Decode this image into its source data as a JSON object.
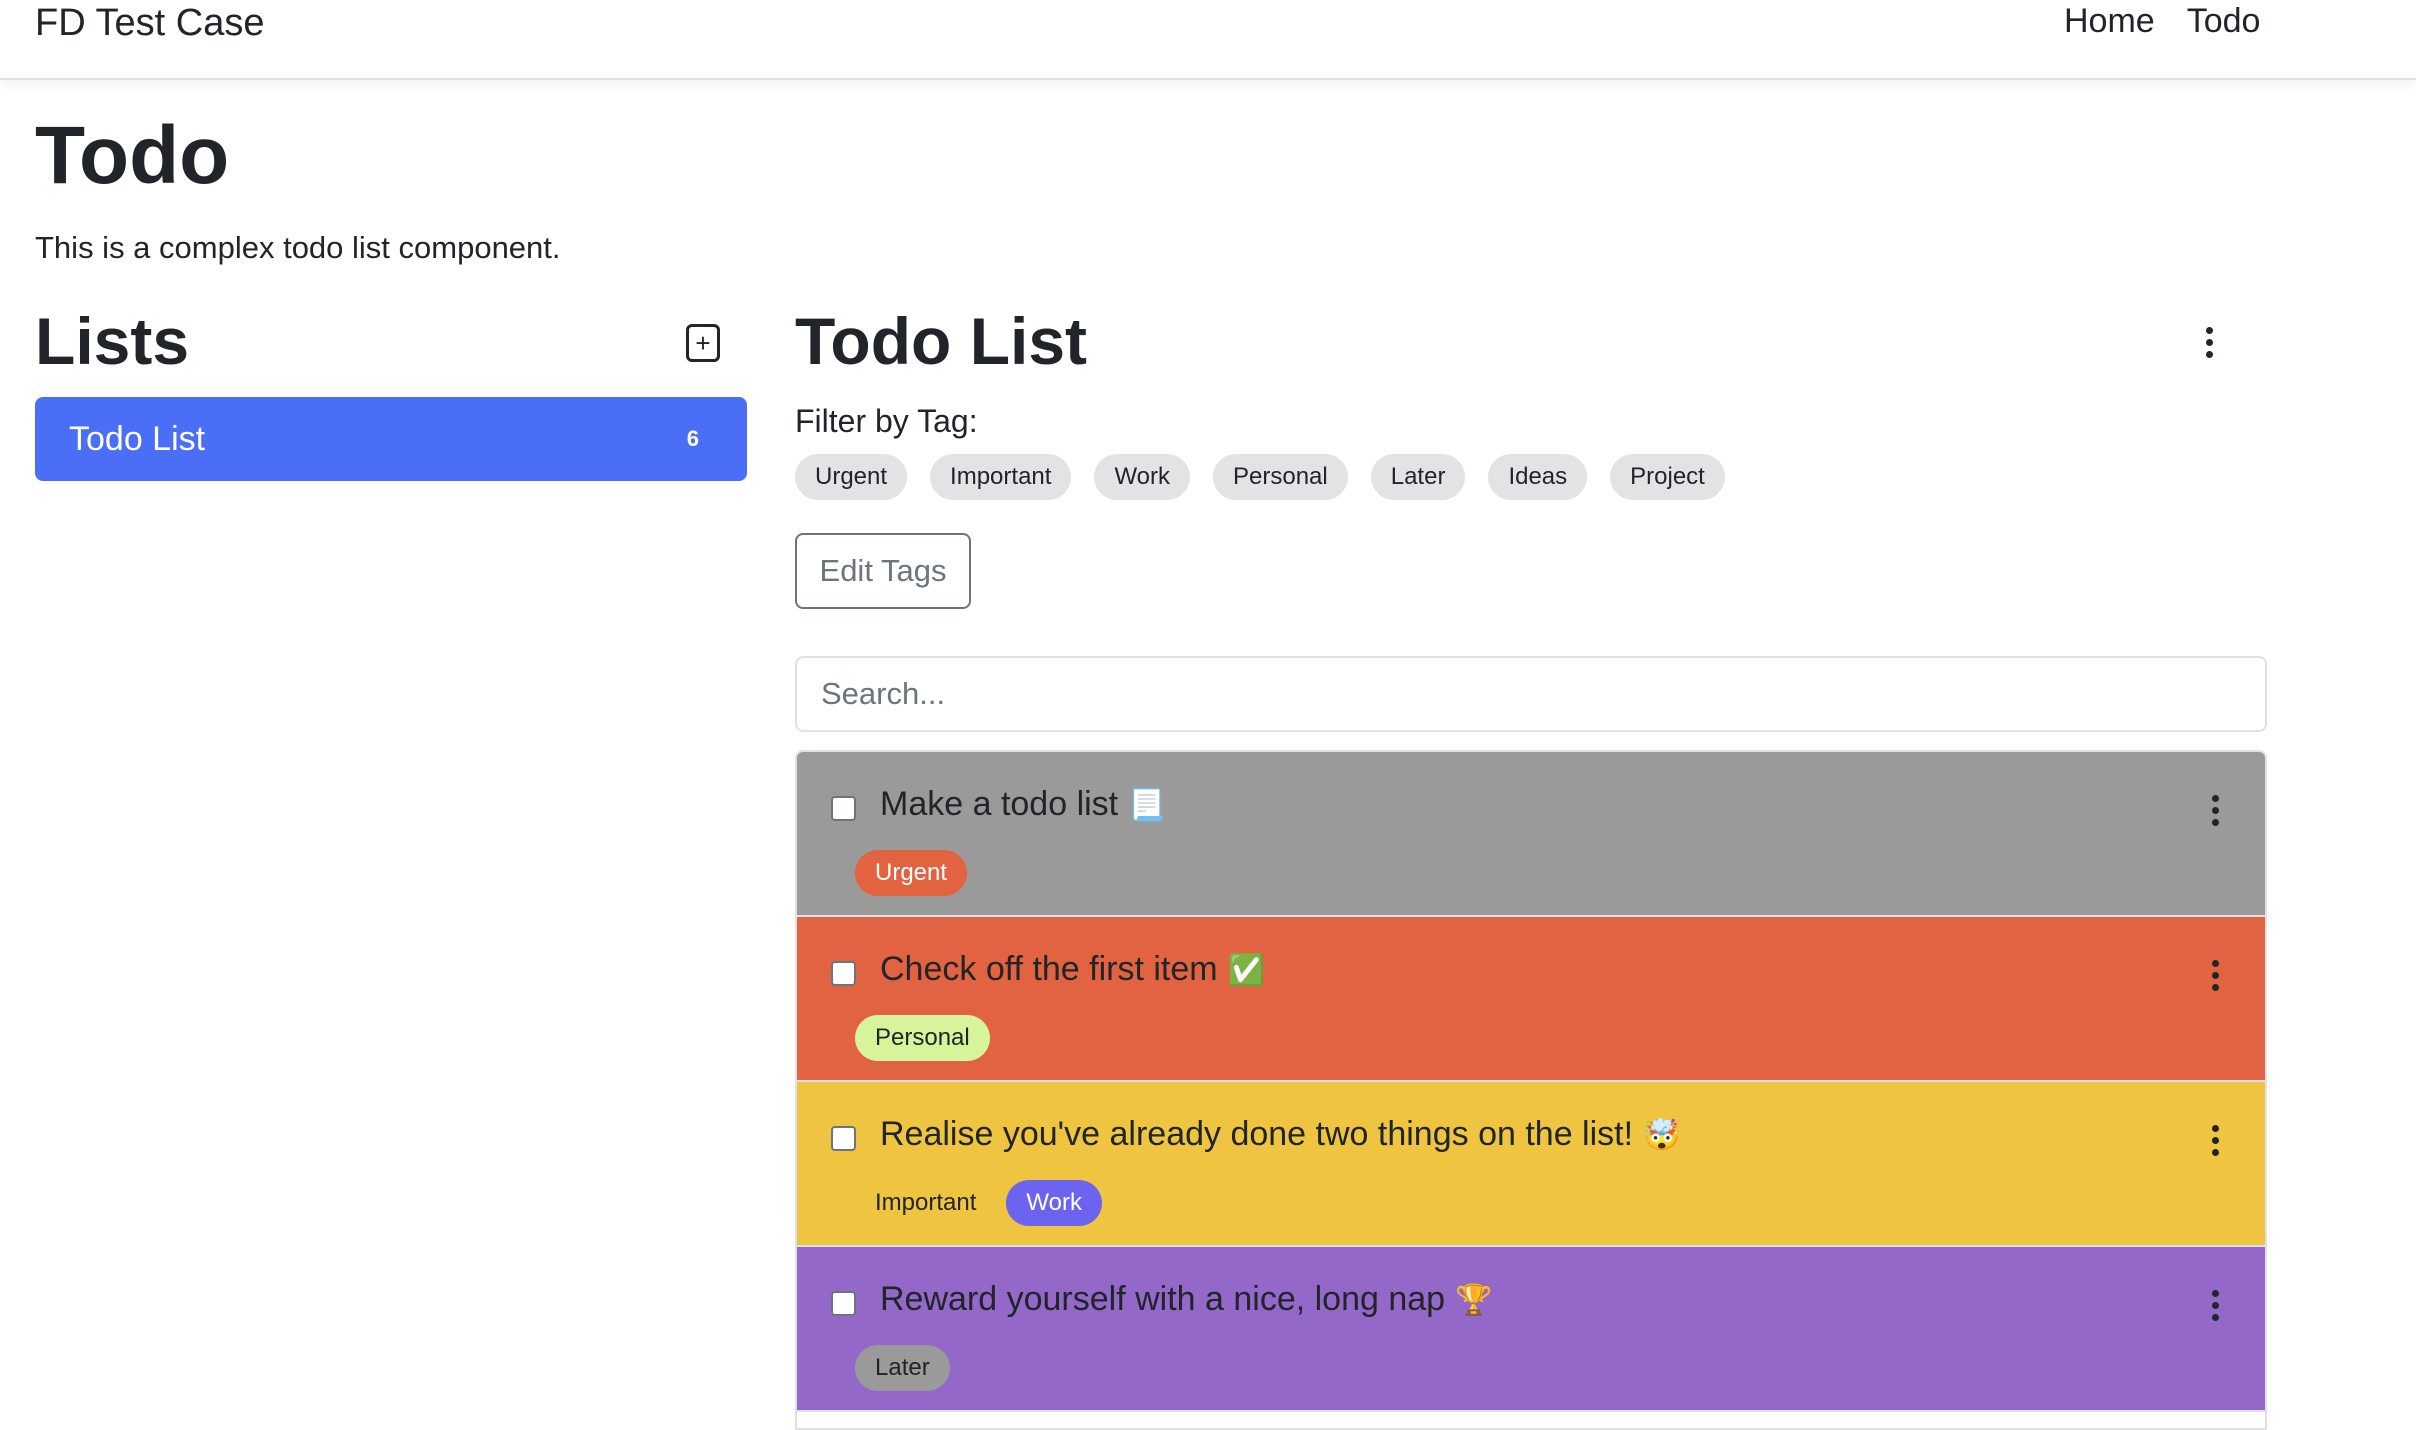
{
  "navbar": {
    "brand": "FD Test Case",
    "links": [
      "Home",
      "Todo"
    ]
  },
  "page": {
    "title": "Todo",
    "description": "This is a complex todo list component."
  },
  "lists": {
    "title": "Lists",
    "add_icon": "notebook-add-icon",
    "items": [
      {
        "label": "Todo List",
        "count": "6",
        "color": "#4a6ef5"
      }
    ]
  },
  "main": {
    "title": "Todo List",
    "menu_icon": "kebab-menu-icon",
    "filter_label": "Filter by Tag:",
    "filter_tags": [
      "Urgent",
      "Important",
      "Work",
      "Personal",
      "Later",
      "Ideas",
      "Project"
    ],
    "edit_tags_label": "Edit Tags",
    "search_placeholder": "Search...",
    "todos": [
      {
        "text": "Make a todo list",
        "emoji": "📃",
        "background": "#9a9a9a",
        "tags": [
          {
            "label": "Urgent",
            "bg": "#e2633f",
            "fg": "#ffffff"
          }
        ]
      },
      {
        "text": "Check off the first item",
        "emoji": "✅",
        "background": "#e26342",
        "tags": [
          {
            "label": "Personal",
            "bg": "#d6f59b",
            "fg": "#212529"
          }
        ]
      },
      {
        "text": "Realise you've already done two things on the list!",
        "emoji": "🤯",
        "background": "#eec441",
        "tags": [
          {
            "label": "Important",
            "bg": "#eec441",
            "fg": "#212529"
          },
          {
            "label": "Work",
            "bg": "#6c63f0",
            "fg": "#ffffff"
          }
        ]
      },
      {
        "text": "Reward yourself with a nice, long nap",
        "emoji": "🏆",
        "background": "#9368c8",
        "tags": [
          {
            "label": "Later",
            "bg": "#9a9a9a",
            "fg": "#212529"
          }
        ]
      }
    ]
  }
}
